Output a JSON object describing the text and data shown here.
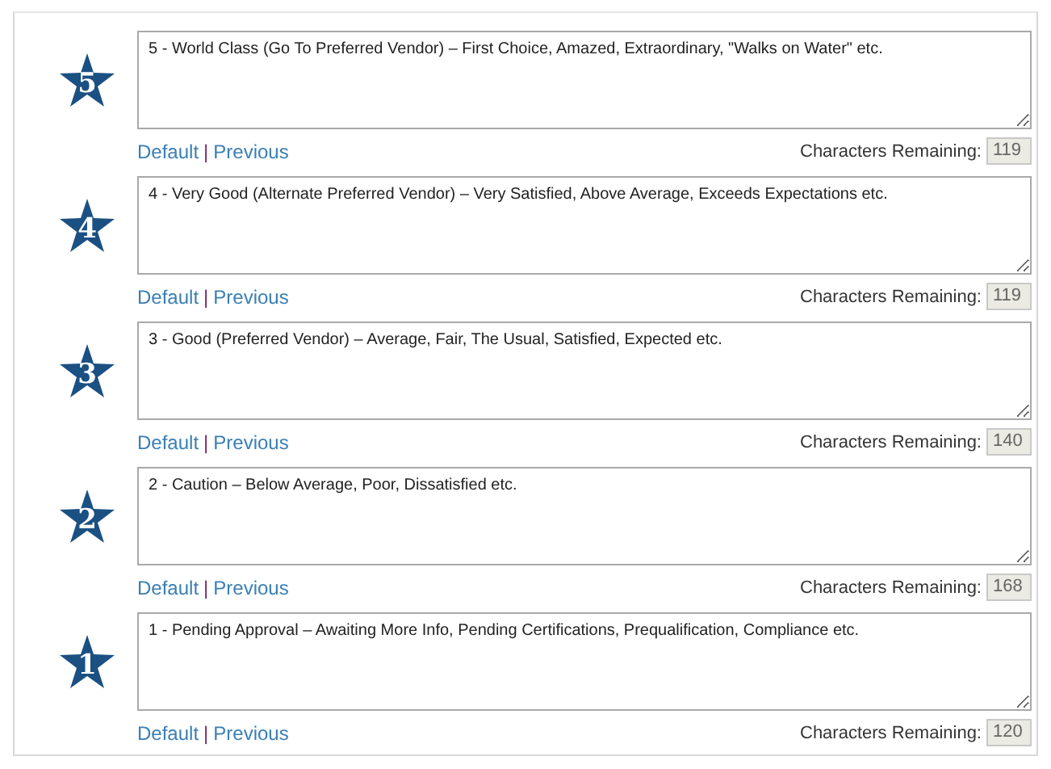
{
  "ratings": [
    {
      "badge": "5",
      "text": "5 - World Class (Go To Preferred Vendor) – First Choice, Amazed, Extraordinary, \"Walks on Water\" etc.",
      "default_link": "Default",
      "separator": "|",
      "previous_link": "Previous",
      "remaining_label": "Characters Remaining:",
      "remaining": "119"
    },
    {
      "badge": "4",
      "text": "4 - Very Good (Alternate Preferred Vendor) – Very Satisfied, Above Average, Exceeds Expectations etc.",
      "default_link": "Default",
      "separator": "|",
      "previous_link": "Previous",
      "remaining_label": "Characters Remaining:",
      "remaining": "119"
    },
    {
      "badge": "3",
      "text": "3 - Good (Preferred Vendor) – Average, Fair, The Usual, Satisfied, Expected etc.",
      "default_link": "Default",
      "separator": "|",
      "previous_link": "Previous",
      "remaining_label": "Characters Remaining:",
      "remaining": "140"
    },
    {
      "badge": "2",
      "text": "2 - Caution – Below Average, Poor, Dissatisfied etc.",
      "default_link": "Default",
      "separator": "|",
      "previous_link": "Previous",
      "remaining_label": "Characters Remaining:",
      "remaining": "168"
    },
    {
      "badge": "1",
      "text": "1 - Pending Approval – Awaiting More Info, Pending Certifications, Prequalification, Compliance etc.",
      "default_link": "Default",
      "separator": "|",
      "previous_link": "Previous",
      "remaining_label": "Characters Remaining:",
      "remaining": "120"
    }
  ]
}
